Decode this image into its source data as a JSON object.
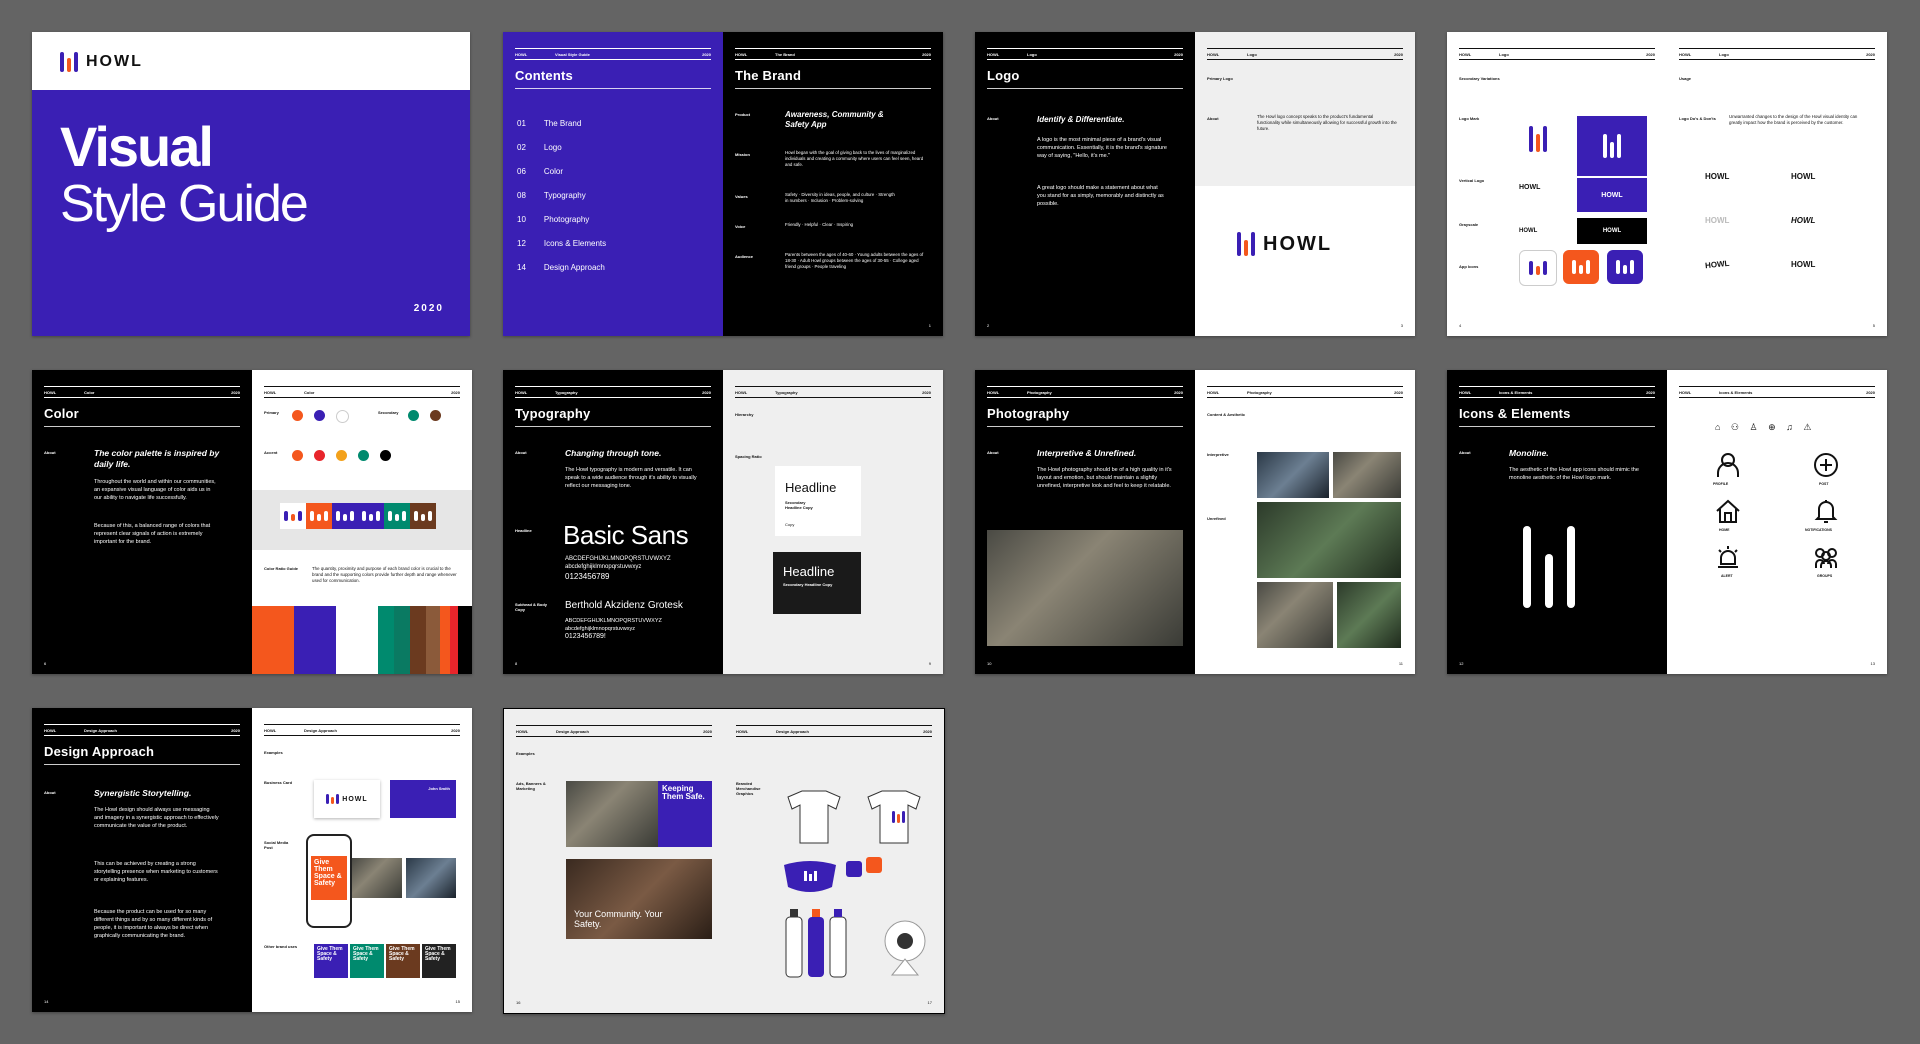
{
  "brand": {
    "word": "HOWL",
    "year": "2020",
    "guide": "Visual Style Guide"
  },
  "colors": {
    "purple": "#3a1fb4",
    "orange": "#f4571d",
    "red": "#e8252b",
    "amber": "#f3a11b",
    "teal": "#008a6e",
    "brown": "#6b3a1f",
    "black": "#000000",
    "white": "#ffffff",
    "gray": "#646464"
  },
  "cover": {
    "title1": "Visual",
    "title2": "Style Guide",
    "year": "2020"
  },
  "contents": {
    "title": "Contents",
    "items": [
      {
        "num": "01",
        "label": "The Brand"
      },
      {
        "num": "02",
        "label": "Logo"
      },
      {
        "num": "06",
        "label": "Color"
      },
      {
        "num": "08",
        "label": "Typography"
      },
      {
        "num": "10",
        "label": "Photography"
      },
      {
        "num": "12",
        "label": "Icons & Elements"
      },
      {
        "num": "14",
        "label": "Design Approach"
      }
    ]
  },
  "header": {
    "word": "HOWL",
    "guide": "Visual Style Guide",
    "year": "2020"
  },
  "brandpage": {
    "title": "The Brand",
    "section": "The Brand",
    "product_label": "Product",
    "product": "Awareness, Community & Safety App",
    "mission_label": "Mission",
    "mission": "Howl began with the goal of giving back to the lives of marginalized individuals and creating a community where users can feel seen, heard and safe.",
    "values_label": "Values",
    "values": "Safety · Diversity in ideas, people, and culture · Strength in numbers · Inclusion · Problem-solving",
    "voice_label": "Voice",
    "voice": "Friendly · Helpful · Clear · Inspiring",
    "audience_label": "Audience",
    "audience": "Parents between the ages of 40-60 · Young adults between the ages of 18-30 · Adult Howl groups between the ages of 30-55 · College aged friend groups · People traveling",
    "page": "1"
  },
  "logo": {
    "title": "Logo",
    "section": "Logo",
    "about_label": "About",
    "headline": "Identify & Differentiate.",
    "p1": "A logo is the most minimal piece of a brand's visual communication. Essentially, it is the brand's signature way of saying, \"Hello, it's me.\"",
    "p2": "A great logo should make a statement about what you stand for as simply, memorably and distinctly as possible.",
    "primary_label": "Primary Logo",
    "primary_text": "The Howl logo concept speaks to the product's fundamental functionality while simultaneously allowing for successful growth into the future.",
    "page_l": "2",
    "page_r": "3"
  },
  "logo2": {
    "section": "Logo",
    "secondary_label": "Secondary Variations",
    "usage_label": "Usage",
    "logomark": "Logo Mark",
    "vertical": "Vertical Logo",
    "grayscale": "Grayscale",
    "appicons": "App Icons",
    "dos": "Logo Do's & Don'ts",
    "usage_text": "Unwarranted changes to the design of the Howl visual identity can greatly impact how the brand is perceived by the customer.",
    "page_l": "4",
    "page_r": "5"
  },
  "color": {
    "title": "Color",
    "section": "Color",
    "about_label": "About",
    "headline": "The color palette is inspired by daily life.",
    "p1": "Throughout the world and within our communities, an expansive visual language of color aids us in our ability to navigate life successfully.",
    "p2": "Because of this, a balanced range of colors that represent clear signals of action is extremely important for the brand.",
    "primary": "Primary",
    "secondary": "Secondary",
    "accent": "Accent",
    "ratio_label": "Color Ratio Guide",
    "ratio_text": "The quantity, proximity and purpose of each brand color is crucial to the brand and the supporting colors provide further depth and range whenever used for communication.",
    "page_l": "6",
    "page_r": "7"
  },
  "typography": {
    "title": "Typography",
    "section": "Typography",
    "about_label": "About",
    "headline": "Changing through tone.",
    "p1": "The Howl typography is modern and versatile. It can speak to a wide audience through it's ability to visually reflect our messaging tone.",
    "headline_label": "Headline",
    "font1": "Basic Sans",
    "alpha1": "ABCDEFGHIJKLMNOPQRSTUVWXYZ",
    "lower1": "abcdefghijklmnopqrstuvwxyz",
    "nums1": "0123456789",
    "body_label": "Subhead & Body Copy",
    "font2": "Berthold Akzidenz Grotesk",
    "alpha2": "ABCDEFGHIJKLMNOPQRSTUVWXYZ",
    "lower2": "abcdefghijklmnopqrstuvwxyz",
    "nums2": "0123456789!",
    "hier_label": "Hierarchy",
    "spacing_label": "Spacing Ratio",
    "h_headline": "Headline",
    "h_sub": "Secondary Headline Copy",
    "h_copy": "Copy",
    "h_headline2": "Headline",
    "h_sub2": "Secondary Headline Copy",
    "page_l": "8",
    "page_r": "9"
  },
  "photography": {
    "title": "Photography",
    "section": "Photography",
    "about_label": "About",
    "headline": "Interpretive & Unrefined.",
    "p1": "The Howl photography should be of a high quality in it's layout and emotion, but should maintain a slightly unrefined, interpretive look and feel to keep it relatable.",
    "content_label": "Content & Aesthetic",
    "interpretive": "Interpretive",
    "unrefined": "Unrefined",
    "page_l": "10",
    "page_r": "11"
  },
  "icons": {
    "title": "Icons & Elements",
    "section": "Icons & Elements",
    "about_label": "About",
    "headline": "Monoline.",
    "p1": "The aesthetic of the Howl app icons should mimic the monoline aesthetic of the Howl logo mark.",
    "labels": [
      "PROFILE",
      "POST",
      "HOME",
      "NOTIFICATIONS",
      "ALERT",
      "GROUPS"
    ],
    "page_l": "12",
    "page_r": "13"
  },
  "design": {
    "title": "Design Approach",
    "section": "Design Approach",
    "about_label": "About",
    "headline": "Synergistic Storytelling.",
    "p1": "The Howl design should always use messaging and imagery in a synergistic approach to effectively communicate the value of the product.",
    "p2": "This can be achieved by creating a strong storytelling presence when marketing to customers or explaining features.",
    "p3": "Because the product can be used for so many different things and by so many different kinds of people, it is important to always be direct when graphically communicating the brand.",
    "examples": "Examples",
    "bizcard": "Business Card",
    "social": "Social Media Post",
    "other": "Other brand uses",
    "give": "Give Them Space & Safety",
    "card_name": "John Smith",
    "page_l": "14",
    "page_r": "15"
  },
  "examples2": {
    "section": "Design Approach",
    "examples": "Examples",
    "ads": "Ads, Banners & Marketing",
    "merch": "Branded Merchandise Graphics",
    "keeping": "Keeping Them Safe.",
    "community": "Your Community. Your Safety.",
    "page_l": "16",
    "page_r": "17"
  }
}
